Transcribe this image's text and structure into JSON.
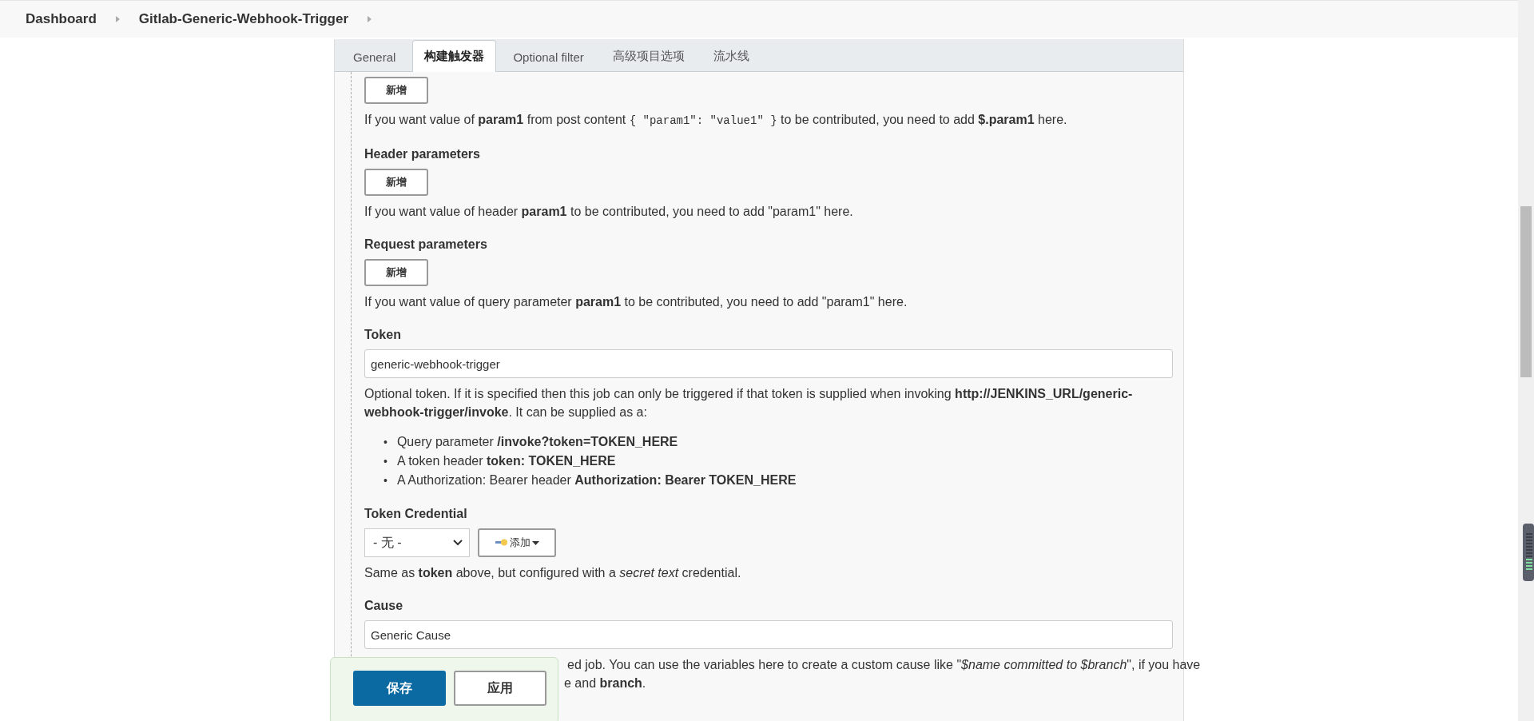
{
  "breadcrumb": [
    {
      "label": "Dashboard"
    },
    {
      "label": "Gitlab-Generic-Webhook-Trigger"
    }
  ],
  "tabs": [
    {
      "label": "General",
      "selected": false
    },
    {
      "label": "构建触发器",
      "selected": true
    },
    {
      "label": "Optional filter",
      "selected": false
    },
    {
      "label": "高级项目选项",
      "selected": false
    },
    {
      "label": "流水线",
      "selected": false
    }
  ],
  "sections": [
    {
      "kind": "add",
      "add_button": "新增",
      "help": [
        {
          "kind": "plain",
          "text": "If you want value of "
        },
        {
          "kind": "bold",
          "text": "param1"
        },
        {
          "kind": "plain",
          "text": " from post content "
        },
        {
          "kind": "code",
          "text": "{ ″param1″: ″value1″ }"
        },
        {
          "kind": "plain",
          "text": " to be contributed, you need to add "
        },
        {
          "kind": "bold",
          "text": "$.param1"
        },
        {
          "kind": "plain",
          "text": " here."
        }
      ]
    },
    {
      "kind": "add",
      "title": "Header parameters",
      "add_button": "新增",
      "help": [
        {
          "kind": "plain",
          "text": "If you want value of header "
        },
        {
          "kind": "bold",
          "text": "param1"
        },
        {
          "kind": "plain",
          "text": " to be contributed, you need to add \"param1\" here."
        }
      ]
    },
    {
      "kind": "add",
      "title": "Request parameters",
      "add_button": "新增",
      "help": [
        {
          "kind": "plain",
          "text": "If you want value of query parameter "
        },
        {
          "kind": "bold",
          "text": "param1"
        },
        {
          "kind": "plain",
          "text": " to be contributed, you need to add \"param1\" here."
        }
      ]
    },
    {
      "kind": "input",
      "title": "Token",
      "value": "generic-webhook-trigger",
      "help": [
        {
          "kind": "plain",
          "text": "Optional token. If it is specified then this job can only be triggered if that token is supplied when invoking "
        },
        {
          "kind": "bold",
          "text": "http://JENKINS_URL/generic-webhook-trigger/invoke"
        },
        {
          "kind": "plain",
          "text": ". It can be supplied as a:"
        }
      ],
      "bullets": [
        {
          "marker": "•",
          "text": "Query parameter **/invoke?token=TOKEN_HERE**"
        },
        {
          "marker": "•",
          "text": "A token header **token: TOKEN_HERE**"
        },
        {
          "marker": "•",
          "text": "A Authorization: Bearer header **Authorization: Bearer TOKEN_HERE**"
        }
      ]
    },
    {
      "kind": "credential",
      "title": "Token Credential",
      "select": "- 无 -",
      "add_button": "添加",
      "help": [
        {
          "kind": "plain",
          "text": "Same as "
        },
        {
          "kind": "bold",
          "text": "token"
        },
        {
          "kind": "plain",
          "text": " above, but configured with a "
        },
        {
          "kind": "italic",
          "text": "secret text"
        },
        {
          "kind": "plain",
          "text": " credential."
        }
      ]
    },
    {
      "kind": "input",
      "title": "Cause",
      "value": "Generic Cause",
      "help": [
        {
          "kind": "plain",
          "text": "ed job. You can use the variables here to create a custom cause like \""
        },
        {
          "kind": "italic",
          "text": "$name committed to $branch"
        },
        {
          "kind": "plain",
          "text": "\", if you have"
        }
      ],
      "help_tail": "e and **branch**."
    }
  ],
  "save_bar": {
    "save": "保存",
    "apply": "应用"
  }
}
